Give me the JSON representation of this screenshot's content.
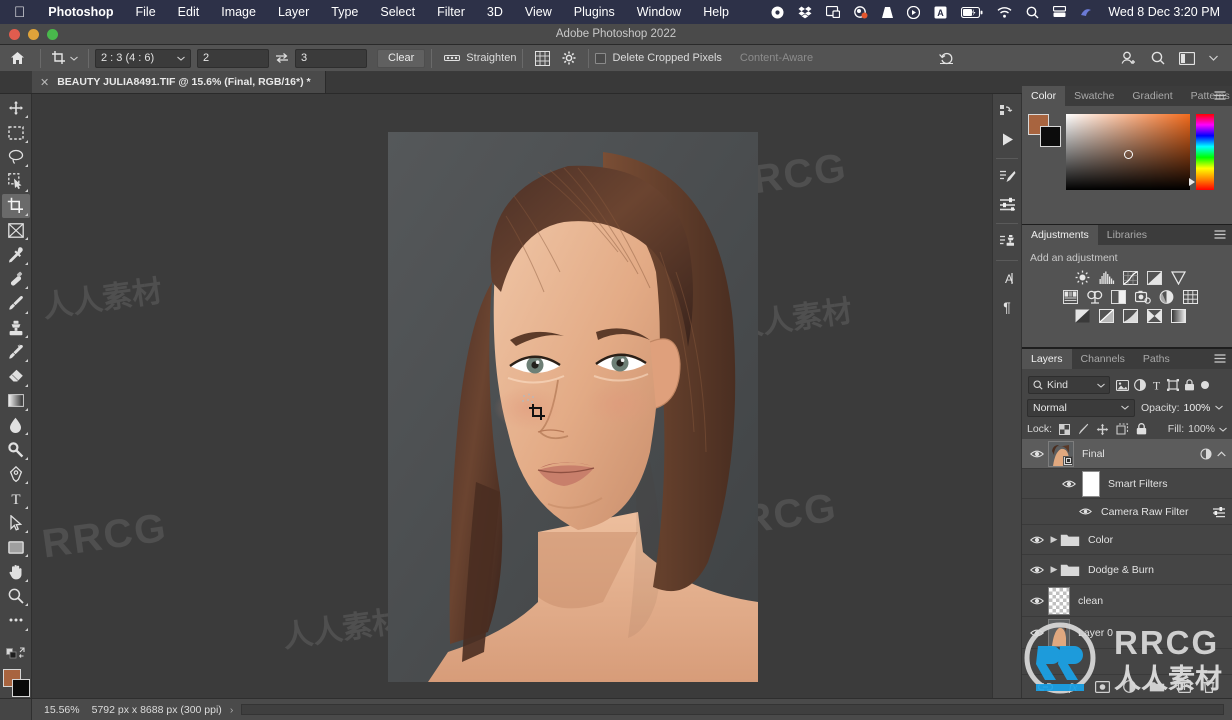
{
  "macbar": {
    "apple_icon": "apple-icon",
    "items": [
      {
        "label": "Photoshop",
        "bold": true
      },
      {
        "label": "File",
        "bold": false
      },
      {
        "label": "Edit",
        "bold": false
      },
      {
        "label": "Image",
        "bold": false
      },
      {
        "label": "Layer",
        "bold": false
      },
      {
        "label": "Type",
        "bold": false
      },
      {
        "label": "Select",
        "bold": false
      },
      {
        "label": "Filter",
        "bold": false
      },
      {
        "label": "3D",
        "bold": false
      },
      {
        "label": "View",
        "bold": false
      },
      {
        "label": "Plugins",
        "bold": false
      },
      {
        "label": "Window",
        "bold": false
      },
      {
        "label": "Help",
        "bold": false
      }
    ],
    "tray": [
      "record-icon",
      "dropbox-icon",
      "screenshot-icon",
      "cleanshot-icon",
      "vlc-icon",
      "play-icon",
      "alfred-icon",
      "battery-icon",
      "wifi-icon",
      "search-icon",
      "control-center-icon",
      "user-icon"
    ],
    "clock": "Wed 8 Dec  3:20 PM",
    "bg_color": "#2d3148"
  },
  "window": {
    "title": "Adobe Photoshop 2022",
    "traffic_lights": [
      "close-button",
      "minimize-button",
      "zoom-button"
    ]
  },
  "options_bar": {
    "home_icon": "home-icon",
    "tool_icon": "crop-tool-icon",
    "ratio_preset": "2 : 3 (4 : 6)",
    "width_value": "2",
    "swap_icon": "swap-arrows-icon",
    "height_value": "3",
    "clear_label": "Clear",
    "straighten_icon": "straighten-icon",
    "straighten_label": "Straighten",
    "overlay_icon": "grid-overlay-icon",
    "settings_icon": "gear-icon",
    "delete_cropped_label": "Delete Cropped Pixels",
    "content_aware_label": "Content-Aware",
    "reset_icon": "reset-arrow-icon",
    "share_icon": "share-person-icon",
    "search_icon": "search-icon",
    "workspace_icon": "workspace-icon"
  },
  "doc_tab": {
    "close_icon": "close-icon",
    "title": "BEAUTY JULIA8491.TIF @ 15.6% (Final, RGB/16*) *"
  },
  "toolbar": {
    "tools": [
      {
        "name": "move-tool",
        "icon": "move-icon",
        "active": false
      },
      {
        "name": "marquee-tool",
        "icon": "rect-marquee-icon",
        "active": false
      },
      {
        "name": "lasso-tool",
        "icon": "lasso-icon",
        "active": false
      },
      {
        "name": "quick-selection-tool",
        "icon": "quick-select-icon",
        "active": false
      },
      {
        "name": "crop-tool",
        "icon": "crop-icon",
        "active": true
      },
      {
        "name": "frame-tool",
        "icon": "frame-icon",
        "active": false
      },
      {
        "name": "eyedropper-tool",
        "icon": "eyedropper-icon",
        "active": false
      },
      {
        "name": "healing-brush-tool",
        "icon": "healing-brush-icon",
        "active": false
      },
      {
        "name": "brush-tool",
        "icon": "brush-icon",
        "active": false
      },
      {
        "name": "clone-stamp-tool",
        "icon": "clone-stamp-icon",
        "active": false
      },
      {
        "name": "history-brush-tool",
        "icon": "history-brush-icon",
        "active": false
      },
      {
        "name": "eraser-tool",
        "icon": "eraser-icon",
        "active": false
      },
      {
        "name": "gradient-tool",
        "icon": "gradient-icon",
        "active": false
      },
      {
        "name": "blur-tool",
        "icon": "blur-drop-icon",
        "active": false
      },
      {
        "name": "dodge-tool",
        "icon": "dodge-icon",
        "active": false
      },
      {
        "name": "pen-tool",
        "icon": "pen-icon",
        "active": false
      },
      {
        "name": "type-tool",
        "icon": "type-t-icon",
        "active": false
      },
      {
        "name": "path-selection-tool",
        "icon": "path-arrow-icon",
        "active": false
      },
      {
        "name": "shape-tool",
        "icon": "rectangle-icon",
        "active": false
      },
      {
        "name": "hand-tool",
        "icon": "hand-icon",
        "active": false
      },
      {
        "name": "zoom-tool",
        "icon": "magnifier-icon",
        "active": false
      },
      {
        "name": "edit-toolbar",
        "icon": "ellipsis-icon",
        "active": false
      }
    ],
    "foreground_color": "#a8643f",
    "background_color": "#0a0a0a"
  },
  "right_rail": {
    "items": [
      "history-panel-icon",
      "actions-play-icon",
      "brush-settings-icon",
      "properties-sliders-icon",
      "clone-source-icon",
      "character-panel-icon",
      "paragraph-panel-icon"
    ]
  },
  "color_panel": {
    "tabs": [
      {
        "label": "Color",
        "active": true
      },
      {
        "label": "Swatche",
        "active": false
      },
      {
        "label": "Gradient",
        "active": false
      },
      {
        "label": "Patterns",
        "active": false
      }
    ],
    "menu_icon": "panel-menu-icon",
    "foreground_color": "#a8643f",
    "background_color": "#0c0c0c",
    "picker_icon": "color-field",
    "hue_slider_icon": "hue-slider"
  },
  "adjustments_panel": {
    "tabs": [
      {
        "label": "Adjustments",
        "active": true
      },
      {
        "label": "Libraries",
        "active": false
      }
    ],
    "menu_icon": "panel-menu-icon",
    "heading": "Add an adjustment",
    "row1": [
      "brightness-contrast-icon",
      "levels-icon",
      "curves-icon",
      "exposure-icon",
      "vibrance-icon"
    ],
    "row2": [
      "hue-saturation-icon",
      "color-balance-icon",
      "black-white-icon",
      "photo-filter-icon",
      "channel-mixer-icon",
      "color-lookup-icon"
    ],
    "row3": [
      "invert-icon",
      "posterize-icon",
      "threshold-icon",
      "selective-color-icon",
      "gradient-map-icon"
    ]
  },
  "layers_panel": {
    "tabs": [
      {
        "label": "Layers",
        "active": true
      },
      {
        "label": "Channels",
        "active": false
      },
      {
        "label": "Paths",
        "active": false
      }
    ],
    "menu_icon": "panel-menu-icon",
    "filter": {
      "search_icon": "search-icon",
      "kind_label": "Kind",
      "chevron_icon": "chevron-down-icon",
      "type_icons": [
        "pixel-filter-icon",
        "adjustment-filter-icon",
        "type-filter-icon",
        "shape-filter-icon",
        "smart-object-filter-icon"
      ],
      "toggle_icon": "filter-toggle-icon"
    },
    "blend_mode": "Normal",
    "opacity_label": "Opacity:",
    "opacity_value": "100%",
    "lock_label": "Lock:",
    "lock_icons": [
      "lock-transparency-icon",
      "lock-image-icon",
      "lock-position-icon",
      "lock-artboard-icon",
      "lock-all-icon"
    ],
    "fill_label": "Fill:",
    "fill_value": "100%",
    "rows": [
      {
        "name": "Final",
        "indent": 0,
        "type": "smart-object",
        "selected": true,
        "eye": true,
        "expanded": true,
        "has_chevron": false,
        "right_icons": [
          "smart-filter-badge-icon",
          "collapse-chevron-icon"
        ]
      },
      {
        "name": "Smart Filters",
        "indent": 1,
        "type": "mask",
        "selected": false,
        "eye": true,
        "has_chevron": false,
        "right_icons": []
      },
      {
        "name": "Camera Raw Filter",
        "indent": 2,
        "type": "filter",
        "selected": false,
        "eye": true,
        "has_chevron": false,
        "right_icons": [
          "blend-options-icon"
        ]
      },
      {
        "name": "Color",
        "indent": 0,
        "type": "group",
        "selected": false,
        "eye": true,
        "has_chevron": true,
        "right_icons": []
      },
      {
        "name": "Dodge & Burn",
        "indent": 0,
        "type": "group",
        "selected": false,
        "eye": true,
        "has_chevron": true,
        "right_icons": []
      },
      {
        "name": "clean",
        "indent": 0,
        "type": "pixel-transparent",
        "selected": false,
        "eye": true,
        "has_chevron": false,
        "right_icons": []
      },
      {
        "name": "Layer 0",
        "indent": 0,
        "type": "pixel-photo",
        "selected": false,
        "eye": true,
        "has_chevron": false,
        "right_icons": []
      }
    ],
    "bottom_icons": [
      "link-layers-icon",
      "layer-style-fx-icon",
      "add-mask-icon",
      "new-adjustment-icon",
      "new-group-icon",
      "new-layer-icon",
      "delete-layer-icon"
    ]
  },
  "status_bar": {
    "zoom": "15.56%",
    "doc_dimensions": "5792 px x 8688 px (300 ppi)",
    "arrow_icon": "chevron-right-icon"
  },
  "canvas": {
    "cursor_icon": "crop-cursor-icon",
    "image_alt": "portrait-photo",
    "background_color": "#3b3b3b"
  },
  "watermarks": {
    "brand": "RRCG",
    "chinese": "人人素材",
    "logo_icon": "rrcg-logo-icon"
  }
}
